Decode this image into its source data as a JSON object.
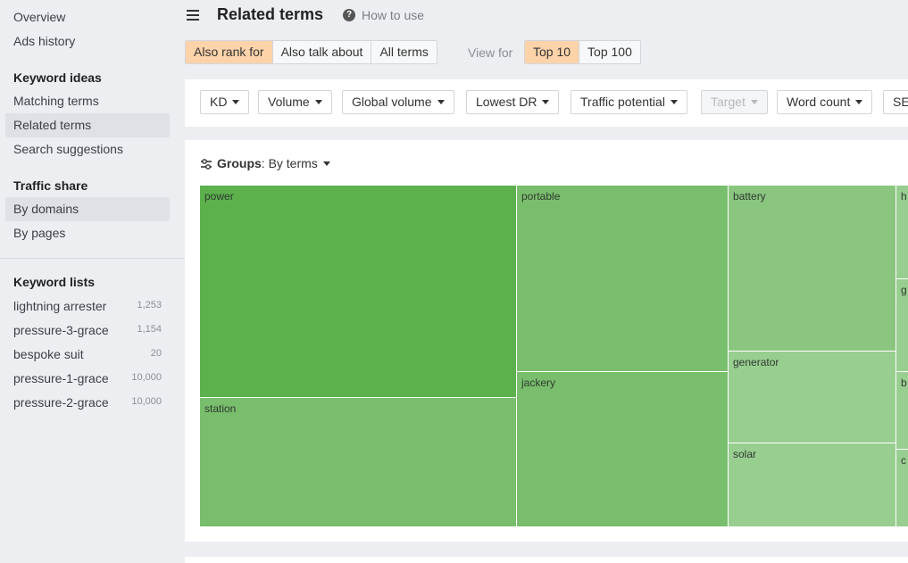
{
  "sidebar": {
    "top_items": [
      {
        "label": "Overview"
      },
      {
        "label": "Ads history"
      }
    ],
    "keyword_ideas": {
      "heading": "Keyword ideas",
      "items": [
        {
          "label": "Matching terms"
        },
        {
          "label": "Related terms"
        },
        {
          "label": "Search suggestions"
        }
      ]
    },
    "traffic_share": {
      "heading": "Traffic share",
      "items": [
        {
          "label": "By domains"
        },
        {
          "label": "By pages"
        }
      ]
    },
    "keyword_lists": {
      "heading": "Keyword lists",
      "items": [
        {
          "label": "lightning arrester",
          "count": "1,253"
        },
        {
          "label": "pressure-3-grace",
          "count": "1,154"
        },
        {
          "label": "bespoke suit",
          "count": "20"
        },
        {
          "label": "pressure-1-grace",
          "count": "10,000"
        },
        {
          "label": "pressure-2-grace",
          "count": "10,000"
        }
      ]
    }
  },
  "header": {
    "title": "Related terms",
    "help_label": "How to use",
    "help_icon": "?"
  },
  "tabs": {
    "mode": [
      "Also rank for",
      "Also talk about",
      "All terms"
    ],
    "mode_selected": "Also rank for",
    "view_for_label": "View for",
    "view": [
      "Top 10",
      "Top 100"
    ],
    "view_selected": "Top 10"
  },
  "filters": [
    {
      "label": "KD"
    },
    {
      "label": "Volume"
    },
    {
      "label": "Global volume"
    },
    {
      "label": "Lowest DR"
    },
    {
      "label": "Traffic potential"
    },
    {
      "label": "Target"
    },
    {
      "label": "Word count"
    },
    {
      "label": "SE"
    }
  ],
  "groups": {
    "label": "Groups",
    "value": "By terms"
  },
  "treemap": {
    "cells": [
      {
        "label": "power",
        "color": "#5cb14d"
      },
      {
        "label": "station",
        "color": "#79be6d"
      },
      {
        "label": "portable",
        "color": "#79be6d"
      },
      {
        "label": "jackery",
        "color": "#79be6d"
      },
      {
        "label": "battery",
        "color": "#8ac680"
      },
      {
        "label": "generator",
        "color": "#98ce90"
      },
      {
        "label": "solar",
        "color": "#98ce90"
      },
      {
        "label": "h",
        "color": "#98ce90"
      },
      {
        "label": "g",
        "color": "#98ce90"
      },
      {
        "label": "b",
        "color": "#98ce90"
      },
      {
        "label": "c",
        "color": "#98ce90"
      }
    ]
  }
}
